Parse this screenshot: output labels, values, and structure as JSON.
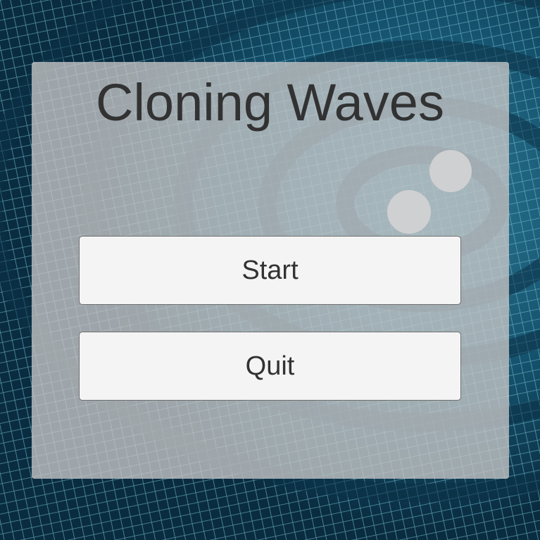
{
  "title": "Cloning Waves",
  "buttons": {
    "start_label": "Start",
    "quit_label": "Quit"
  },
  "colors": {
    "background": "#0e3a52",
    "grid_lines": "#6fb6c8",
    "panel": "#c8c8c8",
    "button_fill": "#f4f4f4",
    "text": "#323232"
  },
  "background_image": "gravitational-wave-grid"
}
